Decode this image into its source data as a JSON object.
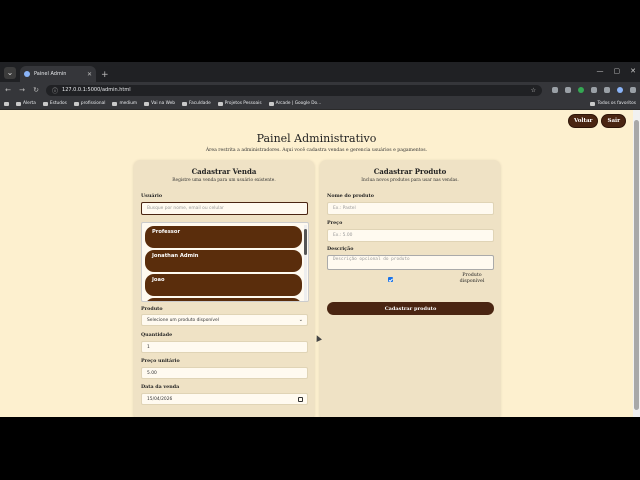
{
  "browser": {
    "tab_title": "Painel Admin",
    "url": "127.0.0.1:5000/admin.html",
    "bookmarks": [
      "Alerta",
      "Estudos",
      "profissional",
      "medium",
      "Vai na Web",
      "Faculdade",
      "Projetos Pessoais",
      "Arcade | Google Do..."
    ],
    "bookmarks_right": "Todos os favoritos"
  },
  "header": {
    "back_label": "Voltar",
    "logout_label": "Sair",
    "title": "Painel Administrativo",
    "subtitle": "Área restrita a administradores. Aqui você cadastra vendas e gerencia usuários e pagamentos."
  },
  "venda": {
    "title": "Cadastrar Venda",
    "hint": "Registre uma venda para um usuário existente.",
    "usuario_label": "Usuário",
    "usuario_placeholder": "Busque por nome, email ou celular",
    "users": [
      {
        "name": "Professor",
        "email": "—"
      },
      {
        "name": "Jonathan Admin",
        "email": "—"
      },
      {
        "name": "Joao",
        "email": "—"
      }
    ],
    "produto_label": "Produto",
    "produto_value": "Selecione um produto disponível",
    "quantidade_label": "Quantidade",
    "quantidade_value": "1",
    "preco_label": "Preço unitário",
    "preco_value": "5.00",
    "data_label": "Data da venda",
    "data_value": "15/04/2026"
  },
  "produto": {
    "title": "Cadastrar Produto",
    "hint": "Inclua novos produtos para usar nas vendas.",
    "nome_label": "Nome do produto",
    "nome_placeholder": "Ex.: Pastel",
    "preco_label": "Preço",
    "preco_placeholder": "Ex.: 5.00",
    "descricao_label": "Descrição",
    "descricao_placeholder": "Descrição opcional do produto",
    "disponivel_label": "Produto disponível",
    "disponivel_checked": true,
    "submit_label": "Cadastrar produto"
  },
  "colors": {
    "page_bg": "#fdf0cf",
    "card_bg": "#efe2c5",
    "brand_brown": "#4a2512",
    "item_brown": "#5a2d0c"
  }
}
